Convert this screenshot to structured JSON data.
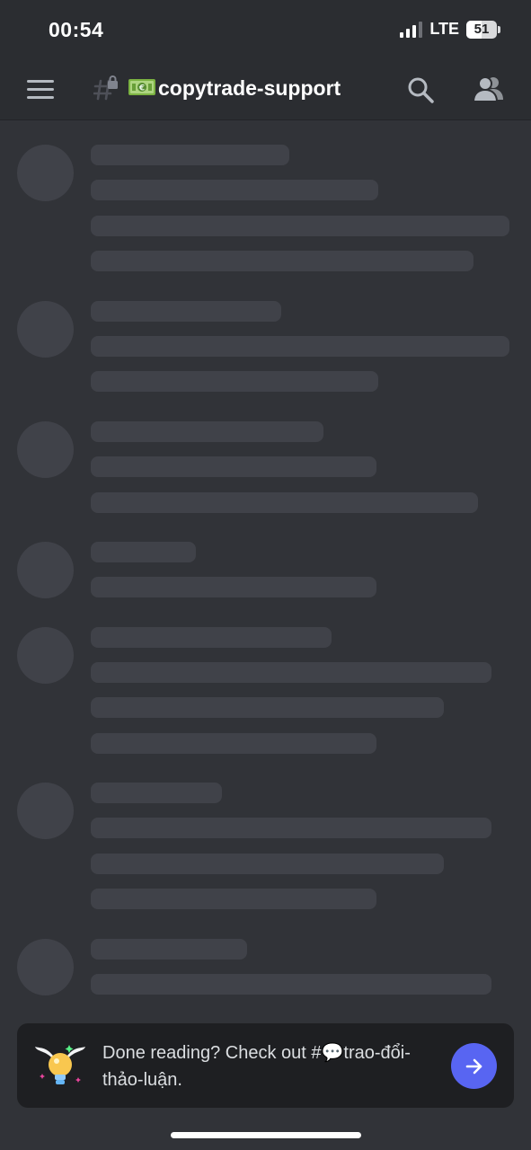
{
  "status_bar": {
    "time": "00:54",
    "network": "LTE",
    "battery": "51"
  },
  "header": {
    "channel_name": "copytrade-support",
    "channel_emoji": "euro-banknote",
    "menu_icon": "hamburger-icon",
    "channel_type_icon": "locked-hash-icon",
    "search_icon": "search-icon",
    "members_icon": "members-icon"
  },
  "banner": {
    "text": "Done reading? Check out #💬trao-đổi-thảo-luận.",
    "icon": "lightbulb-with-wings-icon",
    "action_icon": "arrow-right-icon",
    "accent_color": "#5865f2"
  },
  "colors": {
    "background": "#313338",
    "header_background": "#2b2d31",
    "skeleton": "#404249",
    "banner_background": "#1e1f22"
  }
}
